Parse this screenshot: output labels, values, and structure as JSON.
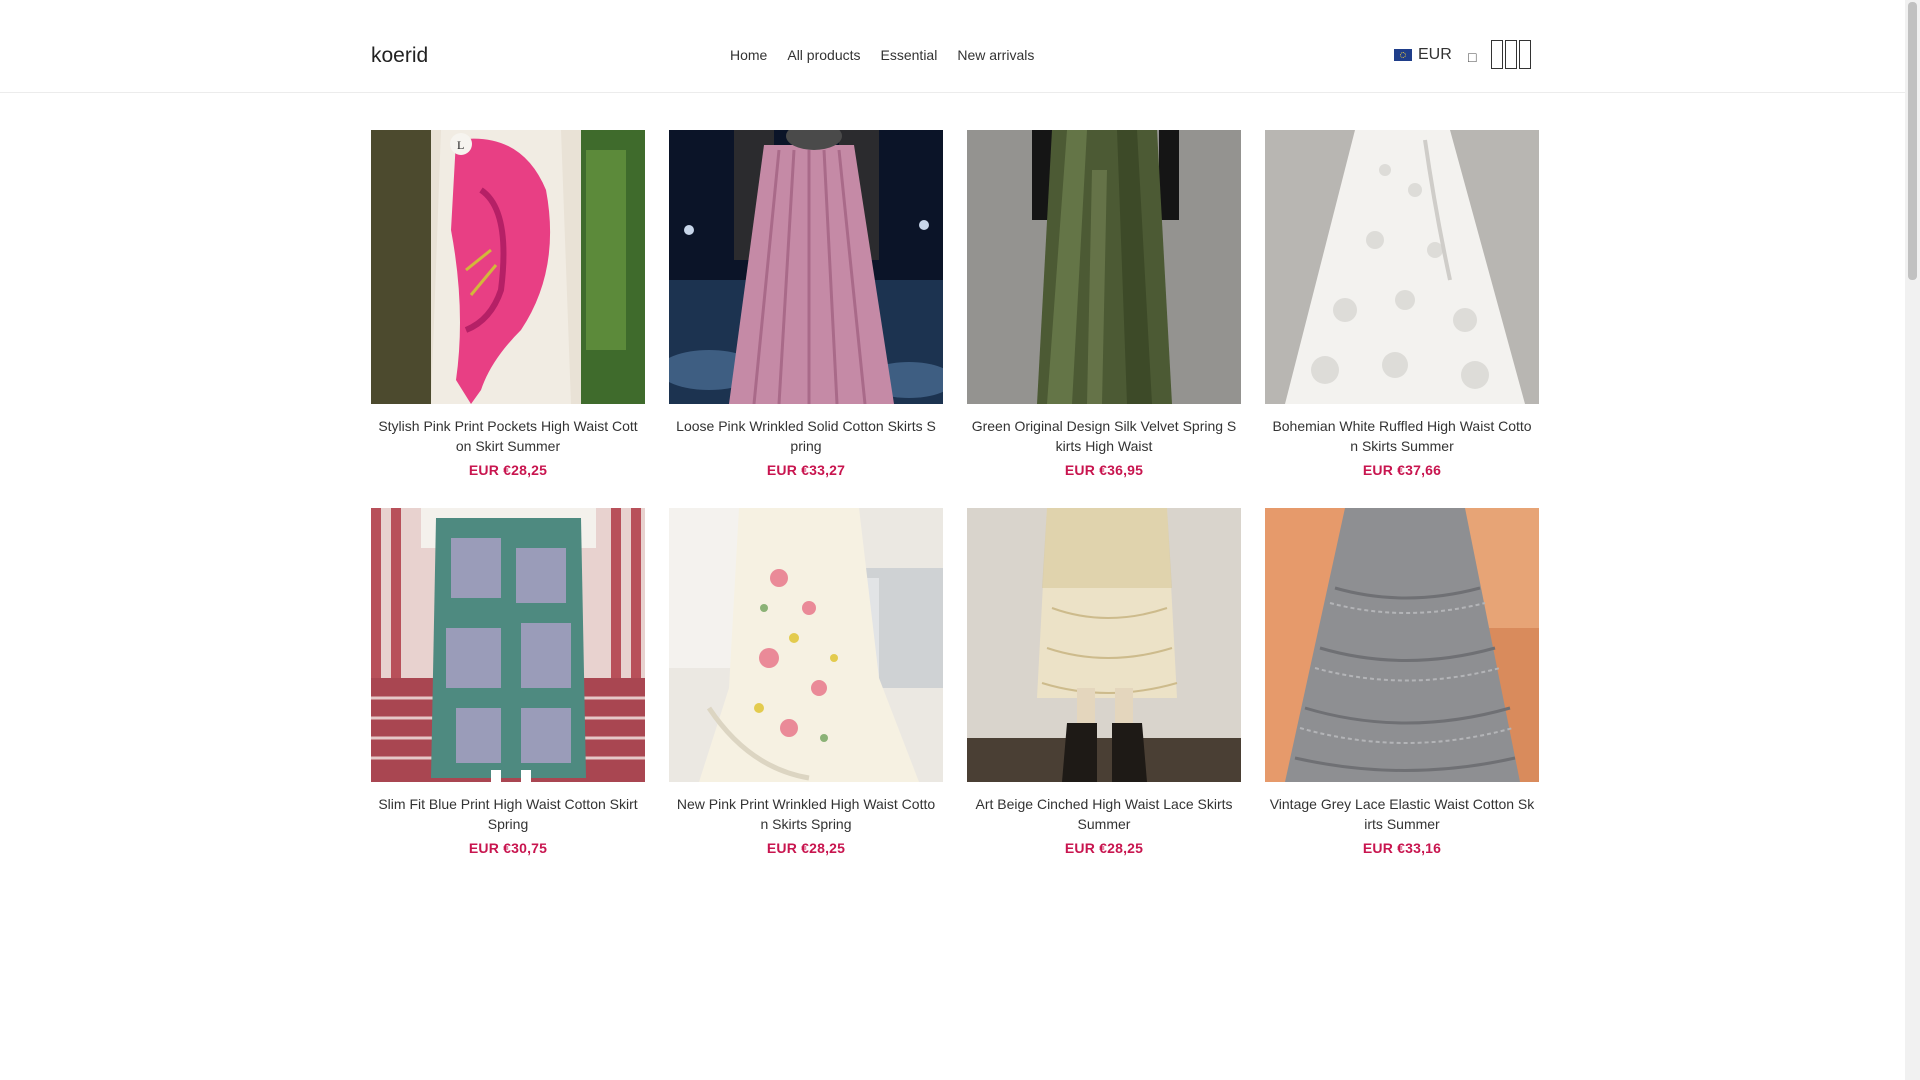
{
  "header": {
    "logo": "koerid",
    "nav": [
      "Home",
      "All products",
      "Essential",
      "New arrivals"
    ],
    "currency": "EUR",
    "icons": [
      "search-icon",
      "account-icon",
      "wishlist-icon",
      "cart-icon"
    ]
  },
  "products": [
    {
      "title": "Stylish Pink Print Pockets High Waist Cotton Skirt Summer",
      "price": "EUR €28,25"
    },
    {
      "title": "Loose Pink Wrinkled Solid Cotton Skirts Spring",
      "price": "EUR €33,27"
    },
    {
      "title": "Green Original Design Silk Velvet Spring Skirts High Waist",
      "price": "EUR €36,95"
    },
    {
      "title": "Bohemian White Ruffled High Waist Cotton Skirts Summer",
      "price": "EUR €37,66"
    },
    {
      "title": "Slim Fit Blue Print High Waist Cotton Skirt Spring",
      "price": "EUR €30,75"
    },
    {
      "title": "New Pink Print Wrinkled High Waist Cotton Skirts Spring",
      "price": "EUR €28,25"
    },
    {
      "title": "Art Beige Cinched High Waist Lace Skirts Summer",
      "price": "EUR €28,25"
    },
    {
      "title": "Vintage Grey Lace Elastic Waist Cotton Skirts Summer",
      "price": "EUR €33,16"
    }
  ],
  "colors": {
    "price": "#c8154f",
    "text": "#333333",
    "border": "#ececec"
  }
}
